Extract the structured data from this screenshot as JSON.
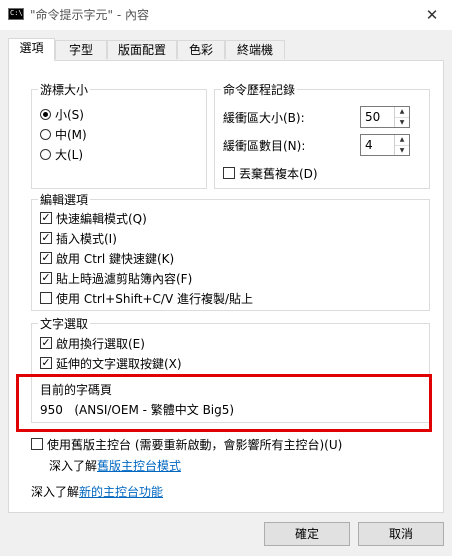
{
  "window": {
    "icon_text": "C:\\",
    "title": "\"命令提示字元\" - 內容",
    "close_glyph": "✕"
  },
  "tabs": [
    {
      "label": "選項",
      "active": true
    },
    {
      "label": "字型"
    },
    {
      "label": "版面配置"
    },
    {
      "label": "色彩"
    },
    {
      "label": "終端機"
    }
  ],
  "cursor_size": {
    "title": "游標大小",
    "options": [
      {
        "label": "小(S)",
        "selected": true
      },
      {
        "label": "中(M)",
        "selected": false
      },
      {
        "label": "大(L)",
        "selected": false
      }
    ]
  },
  "command_history": {
    "title": "命令歷程記錄",
    "buffer_size_label": "緩衝區大小(B):",
    "buffer_size_value": "50",
    "buffer_count_label": "緩衝區數目(N):",
    "buffer_count_value": "4",
    "discard_label": "丟棄舊複本(D)",
    "discard_checked": false
  },
  "edit_options": {
    "title": "編輯選項",
    "items": [
      {
        "label": "快速編輯模式(Q)",
        "checked": true
      },
      {
        "label": "插入模式(I)",
        "checked": true
      },
      {
        "label": "啟用 Ctrl 鍵快速鍵(K)",
        "checked": true
      },
      {
        "label": "貼上時過濾剪貼簿內容(F)",
        "checked": true
      },
      {
        "label": "使用 Ctrl+Shift+C/V 進行複製/貼上",
        "checked": false
      }
    ]
  },
  "text_selection": {
    "title": "文字選取",
    "items": [
      {
        "label": "啟用換行選取(E)",
        "checked": true
      },
      {
        "label": "延伸的文字選取按鍵(X)",
        "checked": true
      }
    ]
  },
  "codepage": {
    "title": "目前的字碼頁",
    "value": "950   (ANSI/OEM - 繁體中文 Big5)"
  },
  "legacy": {
    "label": "使用舊版主控台 (需要重新啟動，會影響所有主控台)(U)",
    "checked": false,
    "learn_prefix": "深入了解",
    "learn_link": "舊版主控台模式"
  },
  "new_features": {
    "prefix": "深入了解",
    "link": "新的主控台功能"
  },
  "buttons": {
    "ok": "確定",
    "cancel": "取消"
  },
  "colors": {
    "highlight_border": "#e00000",
    "link": "#0067c0"
  }
}
